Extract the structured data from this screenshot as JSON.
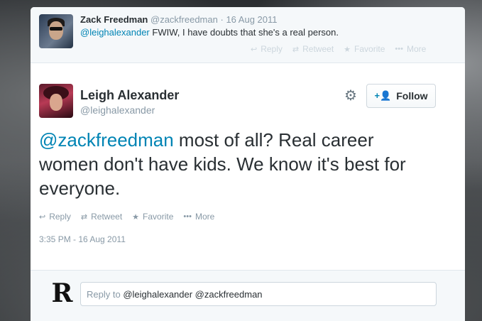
{
  "parent_tweet": {
    "name": "Zack Freedman",
    "handle": "@zackfreedman",
    "separator": "·",
    "date": "16 Aug 2011",
    "mention": "@leighalexander",
    "text": " FWIW, I have doubts that she's a real person.",
    "actions": {
      "reply": "Reply",
      "retweet": "Retweet",
      "favorite": "Favorite",
      "more": "More"
    }
  },
  "tweet": {
    "name": "Leigh Alexander",
    "handle": "@leighalexander",
    "follow_label": "Follow",
    "mention": "@zackfreedman",
    "text": " most of all? Real career women don't have kids. We know it's best for everyone.",
    "actions": {
      "reply": "Reply",
      "retweet": "Retweet",
      "favorite": "Favorite",
      "more": "More"
    },
    "timestamp": "3:35 PM - 16 Aug 2011"
  },
  "reply_box": {
    "prefix": "Reply to ",
    "handles": "@leighalexander @zackfreedman",
    "logo_letter": "R"
  },
  "icons": {
    "reply": "reply-arrow-icon",
    "retweet": "retweet-icon",
    "favorite": "star-icon",
    "more": "ellipsis-icon",
    "settings": "gear-icon",
    "follow": "add-user-icon"
  },
  "colors": {
    "link": "#0084b4",
    "text": "#292f33",
    "muted": "#8899a6"
  }
}
